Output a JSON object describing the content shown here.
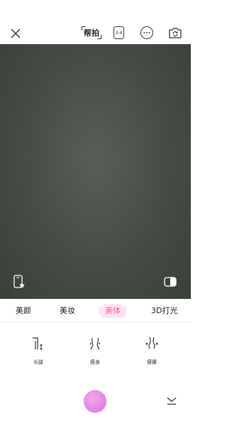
{
  "topbar": {
    "helper_label": "帮拍",
    "ratio_label": "3:4"
  },
  "tabs": [
    {
      "label": "美颜",
      "active": false
    },
    {
      "label": "美妆",
      "active": false
    },
    {
      "label": "美体",
      "active": true
    },
    {
      "label": "3D打光",
      "active": false
    }
  ],
  "tools": [
    {
      "label": "长腿",
      "icon": "long-legs-icon"
    },
    {
      "label": "瘦身",
      "icon": "slim-body-icon"
    },
    {
      "label": "瘦腰",
      "icon": "slim-waist-icon"
    }
  ],
  "colors": {
    "accent": "#ff5fa6",
    "accent_bg": "#fde6f1",
    "preview": "#474b45",
    "shutter": "#e78ee5"
  }
}
